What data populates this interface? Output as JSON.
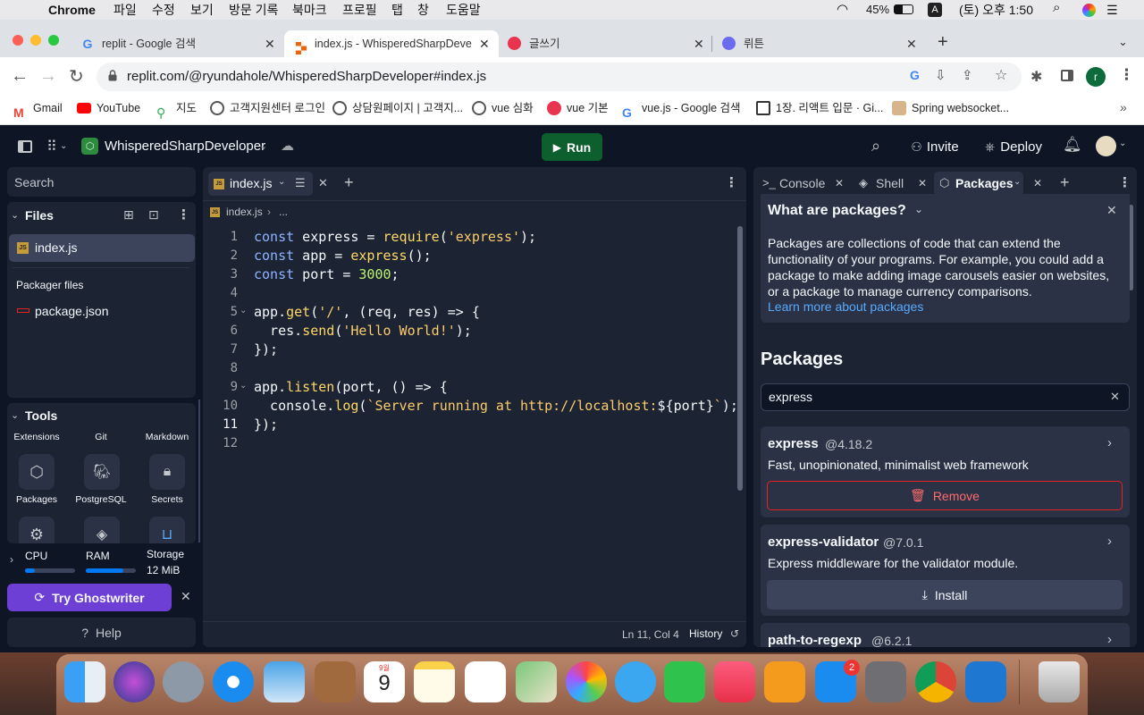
{
  "menubar": {
    "app": "Chrome",
    "menus": [
      "파일",
      "수정",
      "보기",
      "방문 기록",
      "북마크",
      "프로필",
      "탭",
      "창",
      "도움말"
    ],
    "battery": "45%",
    "input": "A",
    "clock": "(토) 오후 1:50"
  },
  "browser": {
    "tabs": [
      {
        "title": "replit - Google 검색"
      },
      {
        "title": "index.js - WhisperedSharpDeve"
      },
      {
        "title": "글쓰기"
      },
      {
        "title": "뤼튼"
      }
    ],
    "url": "replit.com/@ryundahole/WhisperedSharpDeveloper#index.js",
    "profile_initial": "r",
    "bookmarks": [
      "Gmail",
      "YouTube",
      "지도",
      "고객지원센터 로그인",
      "상담원페이지 | 고객지...",
      "vue 심화",
      "vue 기본",
      "vue.js - Google 검색",
      "1장. 리액트 입문 · Gi...",
      "Spring websocket..."
    ]
  },
  "replit": {
    "project_name": "WhisperedSharpDeveloper",
    "run_label": "Run",
    "invite_label": "Invite",
    "deploy_label": "Deploy",
    "search_placeholder": "Search",
    "files_title": "Files",
    "files": [
      {
        "name": "index.js"
      }
    ],
    "packager_files_title": "Packager files",
    "packager_files": [
      {
        "name": "package.json"
      }
    ],
    "tools_title": "Tools",
    "tool_headers": [
      "Extensions",
      "Git",
      "Markdown"
    ],
    "tools_row1": [
      "Packages",
      "PostgreSQL",
      "Secrets"
    ],
    "resources": {
      "cpu": "CPU",
      "cpu_fill": 0.2,
      "ram": "RAM",
      "ram_fill": 0.75,
      "storage": "Storage",
      "storage_value": "12 MiB"
    },
    "ghostwriter_label": "Try Ghostwriter",
    "help_label": "Help",
    "editor": {
      "tab": "index.js",
      "breadcrumb": [
        "index.js",
        "..."
      ],
      "line_numbers": [
        "1",
        "2",
        "3",
        "4",
        "5",
        "6",
        "7",
        "8",
        "9",
        "10",
        "11",
        "12"
      ],
      "status_position": "Ln 11, Col 4",
      "history_label": "History"
    },
    "right_tabs": [
      "Console",
      "Shell",
      "Packages"
    ],
    "info": {
      "title": "What are packages?",
      "body": "Packages are collections of code that can extend the functionality of your programs. For example, you could add a package to make adding image carousels easier on websites, or a package to manage currency comparisons.",
      "link": "Learn more about packages"
    },
    "packages_title": "Packages",
    "package_search": "express",
    "packages": [
      {
        "name": "express",
        "version": "@4.18.2",
        "desc": "Fast, unopinionated, minimalist web framework",
        "action": "Remove"
      },
      {
        "name": "express-validator",
        "version": "@7.0.1",
        "desc": "Express middleware for the validator module.",
        "action": "Install"
      },
      {
        "name": "path-to-regexp",
        "version": "@6.2.1"
      }
    ]
  },
  "dock": {
    "calendar_month": "9월",
    "calendar_day": "9",
    "appstore_badge": "2"
  },
  "colors": {
    "run": "#0e5f2e",
    "remove": "#e52222",
    "link": "#57abff",
    "ghostwriter": "#6e3fd4",
    "panel": "#1c2333"
  }
}
